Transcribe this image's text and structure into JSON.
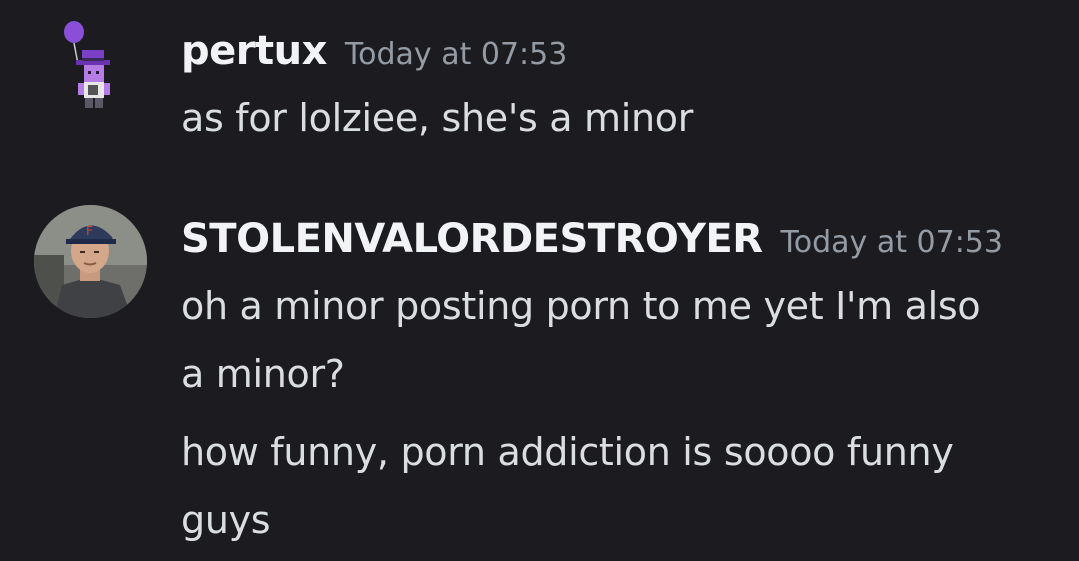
{
  "messages": [
    {
      "username": "pertux",
      "timestamp": "Today at 07:53",
      "lines": [
        "as for lolziee, she's a minor"
      ]
    },
    {
      "username": "STOLENVALORDESTROYER",
      "timestamp": "Today at 07:53",
      "lines": [
        "oh a minor posting porn to me yet I'm also a minor?",
        "how funny, porn addiction is soooo funny guys"
      ]
    }
  ],
  "colors": {
    "background": "#1c1c20",
    "username": "#f2f3f5",
    "timestamp": "#949ba4",
    "message_text": "#dbdee1"
  },
  "icons": [
    "pixel-character-avatar-icon",
    "user-photo-avatar-icon"
  ]
}
